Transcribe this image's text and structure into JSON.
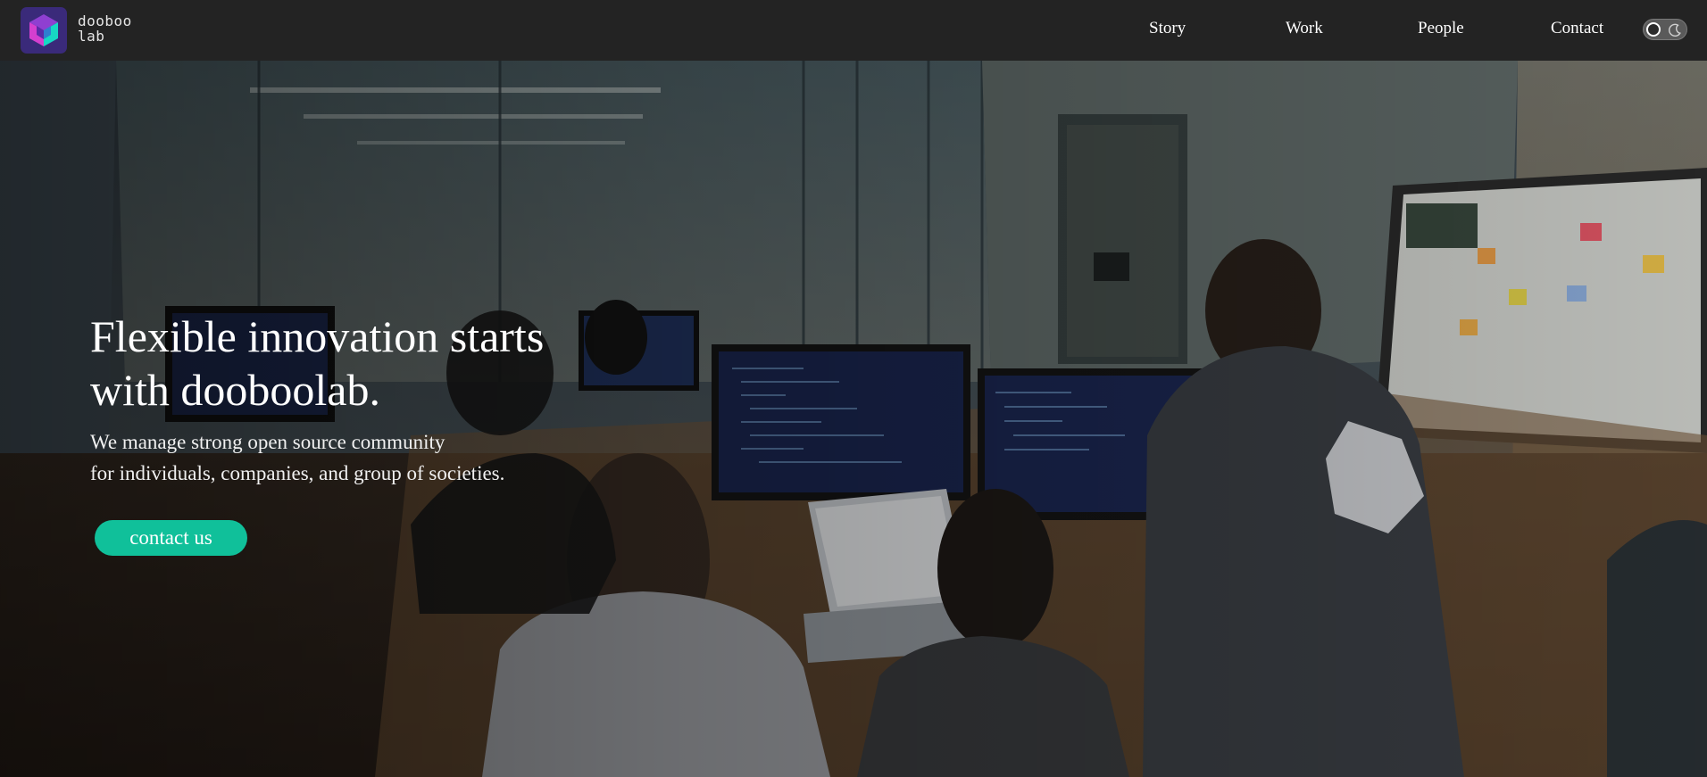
{
  "brand": {
    "name_line1": "dooboo",
    "name_line2": "lab",
    "colors": {
      "magenta": "#c43fd8",
      "cyan": "#16d9c1",
      "purple": "#4b2f9a"
    }
  },
  "nav": {
    "items": [
      {
        "label": "Story"
      },
      {
        "label": "Work"
      },
      {
        "label": "People"
      },
      {
        "label": "Contact"
      }
    ]
  },
  "theme_toggle": {
    "icons": [
      "circle-icon",
      "moon-icon"
    ]
  },
  "hero": {
    "headline_line1": "Flexible innovation starts",
    "headline_line2": "with dooboolab.",
    "sub_line1": "We manage strong open source community",
    "sub_line2": "for individuals, companies, and group of societies.",
    "cta_label": "contact us",
    "cta_color": "#10c09a"
  }
}
